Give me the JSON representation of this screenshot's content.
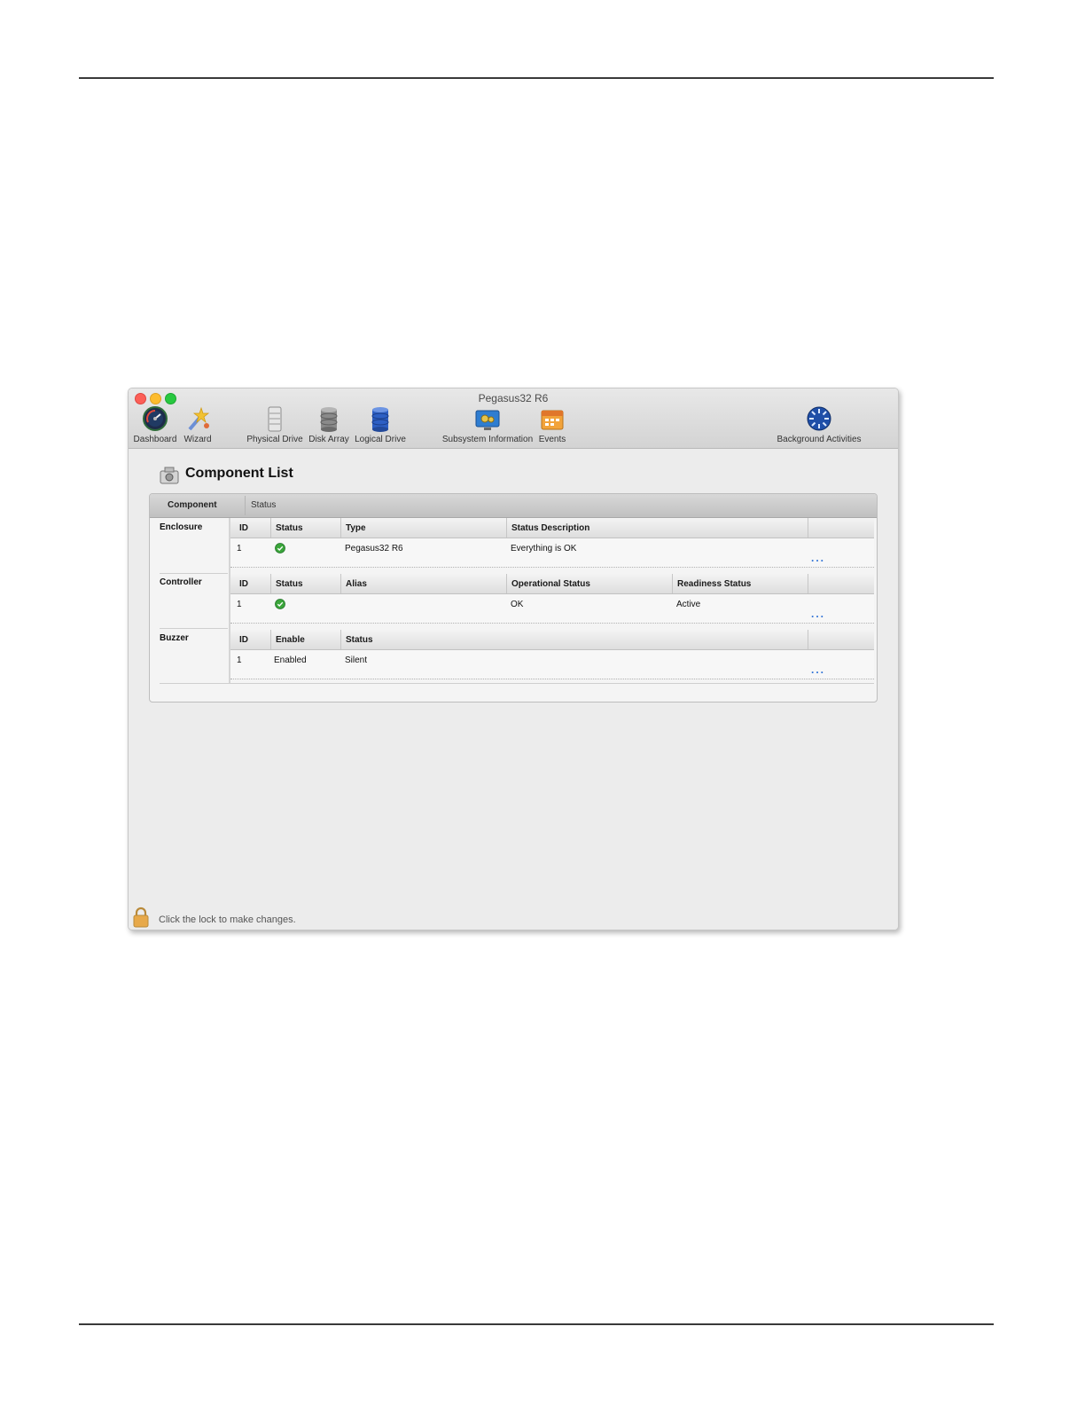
{
  "window": {
    "title": "Pegasus32 R6"
  },
  "toolbar": {
    "items": [
      {
        "label": "Dashboard",
        "icon": "dashboard-icon"
      },
      {
        "label": "Wizard",
        "icon": "wizard-icon"
      },
      {
        "label": "Physical Drive",
        "icon": "physical-drive-icon"
      },
      {
        "label": "Disk Array",
        "icon": "disk-array-icon"
      },
      {
        "label": "Logical Drive",
        "icon": "logical-drive-icon"
      },
      {
        "label": "Subsystem Information",
        "icon": "subsystem-information-icon"
      },
      {
        "label": "Events",
        "icon": "events-icon"
      },
      {
        "label": "Background Activities",
        "icon": "background-activities-icon"
      }
    ]
  },
  "page": {
    "title": "Component List",
    "title_icon": "component-list-icon"
  },
  "panel": {
    "columns": [
      "Component",
      "Status"
    ],
    "enclosure": {
      "label": "Enclosure",
      "headers": [
        "ID",
        "Status",
        "Type",
        "Status Description"
      ],
      "row": {
        "id": "1",
        "status": "ok",
        "type": "Pegasus32 R6",
        "description": "Everything is OK"
      },
      "more": "..."
    },
    "controller": {
      "label": "Controller",
      "headers": [
        "ID",
        "Status",
        "Alias",
        "Operational Status",
        "Readiness Status"
      ],
      "row": {
        "id": "1",
        "status": "ok",
        "alias": "",
        "operational": "OK",
        "readiness": "Active"
      },
      "more": "..."
    },
    "buzzer": {
      "label": "Buzzer",
      "headers": [
        "ID",
        "Enable",
        "Status"
      ],
      "row": {
        "id": "1",
        "enable": "Enabled",
        "status": "Silent"
      },
      "more": "..."
    }
  },
  "footer": {
    "lock_text": "Click the lock to make changes."
  },
  "colors": {
    "ok_green": "#3aa53a",
    "link_blue": "#2b6fd6",
    "lock_orange": "#e7a94a"
  }
}
